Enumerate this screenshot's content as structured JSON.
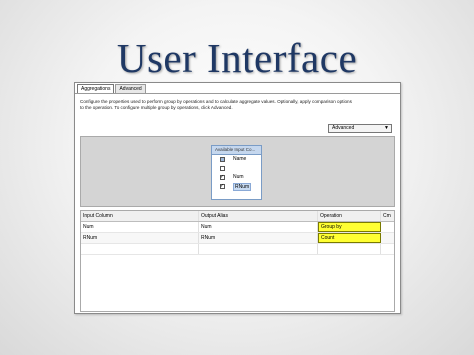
{
  "slide_title": "User Interface",
  "tabs": [
    {
      "label": "Aggregations",
      "active": true
    },
    {
      "label": "Advanced",
      "active": false
    }
  ],
  "description": [
    "Configure the properties used to perform group by operations and to calculate aggregate values. Optionally, apply comparison options",
    "to the operation. To configure multiple group by operations, click Advanced."
  ],
  "advanced_dropdown": {
    "value": "Advanced"
  },
  "available_columns": {
    "title": "Available Input Co...",
    "items": [
      {
        "label": "Name",
        "checked": false
      },
      {
        "label": "",
        "checked": false
      },
      {
        "label": "Num",
        "checked": true
      },
      {
        "label": "RNum",
        "checked": true
      }
    ]
  },
  "grid": {
    "headers": [
      "Input Column",
      "Output Alias",
      "Operation",
      "Cm"
    ],
    "rows": [
      {
        "input": "Num",
        "alias": "Num",
        "operation": "Group by"
      },
      {
        "input": "RNum",
        "alias": "RNum",
        "operation": "Count"
      }
    ]
  },
  "colors": {
    "title": "#1f3864",
    "highlight": "#ffff33"
  }
}
